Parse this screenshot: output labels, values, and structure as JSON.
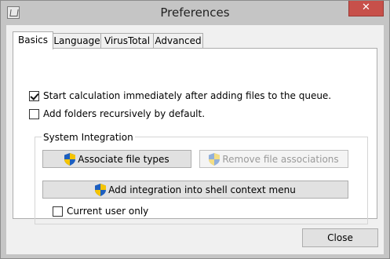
{
  "window": {
    "title": "Preferences",
    "close_glyph": "✕"
  },
  "tabs": [
    {
      "label": "Basics"
    },
    {
      "label": "Language"
    },
    {
      "label": "VirusTotal"
    },
    {
      "label": "Advanced"
    }
  ],
  "basics": {
    "start_calculation": {
      "label": "Start calculation immediately after adding files to the queue.",
      "checked": true
    },
    "add_recursively": {
      "label": "Add folders recursively by default.",
      "checked": false
    },
    "system_integration": {
      "title": "System Integration",
      "associate_button": "Associate file types",
      "remove_button": "Remove file associations",
      "shell_button": "Add integration into shell context menu",
      "current_user": {
        "label": "Current user only",
        "checked": false
      }
    }
  },
  "footer": {
    "close_button": "Close"
  },
  "colors": {
    "title_bar": "#c5c5c5",
    "close_red": "#c7504a",
    "disabled_text": "#9a9a9a"
  },
  "icons": {
    "shield": "uac-shield-icon",
    "app": "app-icon"
  }
}
